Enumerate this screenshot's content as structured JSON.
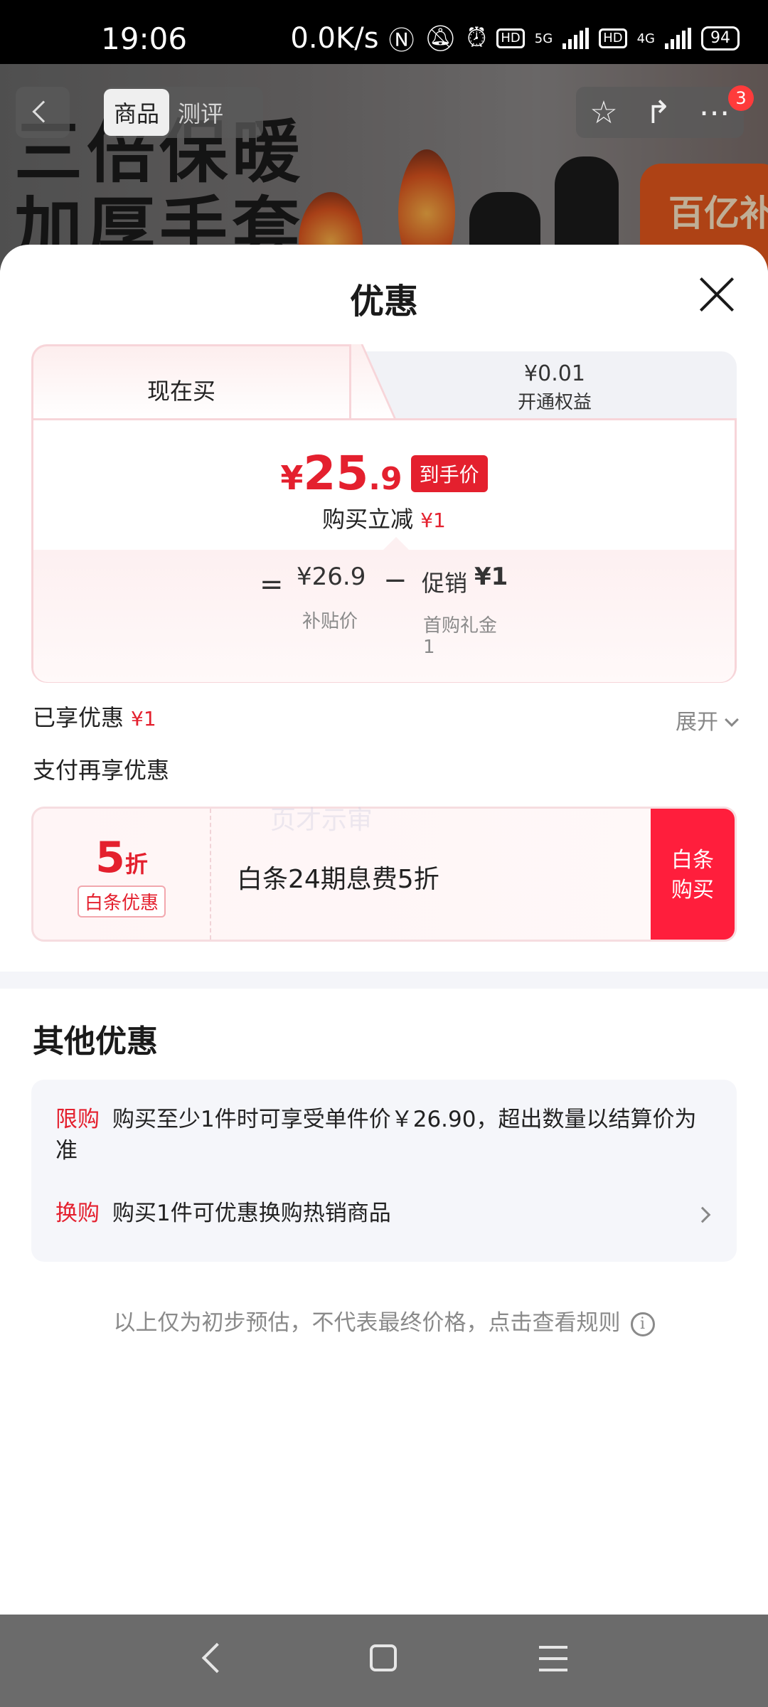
{
  "status_bar": {
    "time": "19:06",
    "net_speed": "0.0K/s",
    "hd1": "HD",
    "net1": "5G",
    "hd2": "HD",
    "net2": "4G",
    "battery": "94"
  },
  "product_header": {
    "hero_text_line1": "三倍保暖",
    "hero_text_line2": "加厚手套",
    "tab_goods": "商品",
    "tab_review": "测评",
    "badge": "百亿补贴",
    "cart_count": "3"
  },
  "sheet": {
    "title": "优惠",
    "tabs": {
      "now": "现在买",
      "alt_price": "¥0.01",
      "alt_label": "开通权益"
    },
    "final": {
      "currency": "¥",
      "integer": "25",
      "decimal": ".9",
      "tag": "到手价"
    },
    "reduce": {
      "label": "购买立减",
      "amount": "¥1"
    },
    "breakdown": {
      "eq": "=",
      "subsidy_value": "¥26.9",
      "subsidy_label": "补贴价",
      "minus": "−",
      "promo_label": "促销",
      "promo_value": "¥1",
      "promo_sub1": "首购礼金",
      "promo_sub2": "1"
    },
    "enjoyed": {
      "label": "已享优惠",
      "amount": "¥1",
      "expand": "展开"
    },
    "pay_more": "支付再享优惠",
    "baitiao": {
      "discount_num": "5",
      "discount_unit": "折",
      "tag": "白条优惠",
      "text": "白条24期息费5折",
      "button_line1": "白条",
      "button_line2": "购买"
    },
    "watermark": "页才示审",
    "other": {
      "title": "其他优惠",
      "row1_tag": "限购",
      "row1_text": "购买至少1件时可享受单件价￥26.90，超出数量以结算价为准",
      "row2_tag": "换购",
      "row2_text": "购买1件可优惠换购热销商品"
    },
    "disclaimer": "以上仅为初步预估，不代表最终价格，点击查看规则"
  },
  "colors": {
    "accent_red": "#e4202e",
    "button_red": "#ff1e3c"
  }
}
